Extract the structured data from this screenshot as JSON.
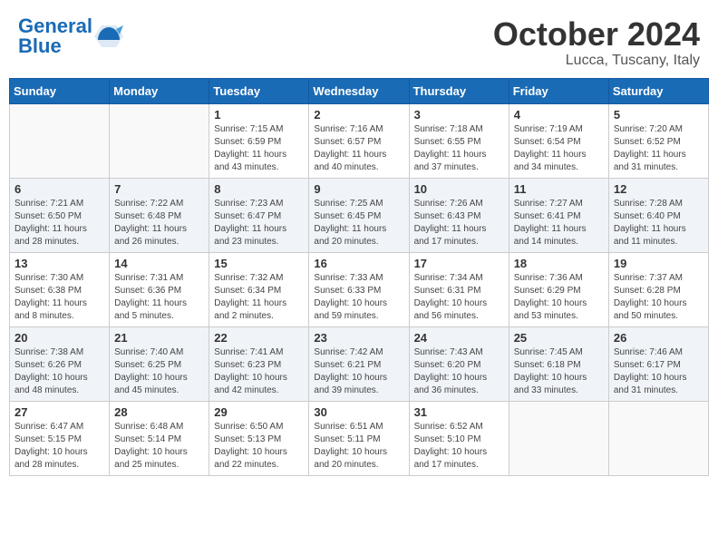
{
  "header": {
    "logo_text_general": "General",
    "logo_text_blue": "Blue",
    "month": "October 2024",
    "location": "Lucca, Tuscany, Italy"
  },
  "days_of_week": [
    "Sunday",
    "Monday",
    "Tuesday",
    "Wednesday",
    "Thursday",
    "Friday",
    "Saturday"
  ],
  "weeks": [
    [
      {
        "day": "",
        "sunrise": "",
        "sunset": "",
        "daylight": ""
      },
      {
        "day": "",
        "sunrise": "",
        "sunset": "",
        "daylight": ""
      },
      {
        "day": "1",
        "sunrise": "Sunrise: 7:15 AM",
        "sunset": "Sunset: 6:59 PM",
        "daylight": "Daylight: 11 hours and 43 minutes."
      },
      {
        "day": "2",
        "sunrise": "Sunrise: 7:16 AM",
        "sunset": "Sunset: 6:57 PM",
        "daylight": "Daylight: 11 hours and 40 minutes."
      },
      {
        "day": "3",
        "sunrise": "Sunrise: 7:18 AM",
        "sunset": "Sunset: 6:55 PM",
        "daylight": "Daylight: 11 hours and 37 minutes."
      },
      {
        "day": "4",
        "sunrise": "Sunrise: 7:19 AM",
        "sunset": "Sunset: 6:54 PM",
        "daylight": "Daylight: 11 hours and 34 minutes."
      },
      {
        "day": "5",
        "sunrise": "Sunrise: 7:20 AM",
        "sunset": "Sunset: 6:52 PM",
        "daylight": "Daylight: 11 hours and 31 minutes."
      }
    ],
    [
      {
        "day": "6",
        "sunrise": "Sunrise: 7:21 AM",
        "sunset": "Sunset: 6:50 PM",
        "daylight": "Daylight: 11 hours and 28 minutes."
      },
      {
        "day": "7",
        "sunrise": "Sunrise: 7:22 AM",
        "sunset": "Sunset: 6:48 PM",
        "daylight": "Daylight: 11 hours and 26 minutes."
      },
      {
        "day": "8",
        "sunrise": "Sunrise: 7:23 AM",
        "sunset": "Sunset: 6:47 PM",
        "daylight": "Daylight: 11 hours and 23 minutes."
      },
      {
        "day": "9",
        "sunrise": "Sunrise: 7:25 AM",
        "sunset": "Sunset: 6:45 PM",
        "daylight": "Daylight: 11 hours and 20 minutes."
      },
      {
        "day": "10",
        "sunrise": "Sunrise: 7:26 AM",
        "sunset": "Sunset: 6:43 PM",
        "daylight": "Daylight: 11 hours and 17 minutes."
      },
      {
        "day": "11",
        "sunrise": "Sunrise: 7:27 AM",
        "sunset": "Sunset: 6:41 PM",
        "daylight": "Daylight: 11 hours and 14 minutes."
      },
      {
        "day": "12",
        "sunrise": "Sunrise: 7:28 AM",
        "sunset": "Sunset: 6:40 PM",
        "daylight": "Daylight: 11 hours and 11 minutes."
      }
    ],
    [
      {
        "day": "13",
        "sunrise": "Sunrise: 7:30 AM",
        "sunset": "Sunset: 6:38 PM",
        "daylight": "Daylight: 11 hours and 8 minutes."
      },
      {
        "day": "14",
        "sunrise": "Sunrise: 7:31 AM",
        "sunset": "Sunset: 6:36 PM",
        "daylight": "Daylight: 11 hours and 5 minutes."
      },
      {
        "day": "15",
        "sunrise": "Sunrise: 7:32 AM",
        "sunset": "Sunset: 6:34 PM",
        "daylight": "Daylight: 11 hours and 2 minutes."
      },
      {
        "day": "16",
        "sunrise": "Sunrise: 7:33 AM",
        "sunset": "Sunset: 6:33 PM",
        "daylight": "Daylight: 10 hours and 59 minutes."
      },
      {
        "day": "17",
        "sunrise": "Sunrise: 7:34 AM",
        "sunset": "Sunset: 6:31 PM",
        "daylight": "Daylight: 10 hours and 56 minutes."
      },
      {
        "day": "18",
        "sunrise": "Sunrise: 7:36 AM",
        "sunset": "Sunset: 6:29 PM",
        "daylight": "Daylight: 10 hours and 53 minutes."
      },
      {
        "day": "19",
        "sunrise": "Sunrise: 7:37 AM",
        "sunset": "Sunset: 6:28 PM",
        "daylight": "Daylight: 10 hours and 50 minutes."
      }
    ],
    [
      {
        "day": "20",
        "sunrise": "Sunrise: 7:38 AM",
        "sunset": "Sunset: 6:26 PM",
        "daylight": "Daylight: 10 hours and 48 minutes."
      },
      {
        "day": "21",
        "sunrise": "Sunrise: 7:40 AM",
        "sunset": "Sunset: 6:25 PM",
        "daylight": "Daylight: 10 hours and 45 minutes."
      },
      {
        "day": "22",
        "sunrise": "Sunrise: 7:41 AM",
        "sunset": "Sunset: 6:23 PM",
        "daylight": "Daylight: 10 hours and 42 minutes."
      },
      {
        "day": "23",
        "sunrise": "Sunrise: 7:42 AM",
        "sunset": "Sunset: 6:21 PM",
        "daylight": "Daylight: 10 hours and 39 minutes."
      },
      {
        "day": "24",
        "sunrise": "Sunrise: 7:43 AM",
        "sunset": "Sunset: 6:20 PM",
        "daylight": "Daylight: 10 hours and 36 minutes."
      },
      {
        "day": "25",
        "sunrise": "Sunrise: 7:45 AM",
        "sunset": "Sunset: 6:18 PM",
        "daylight": "Daylight: 10 hours and 33 minutes."
      },
      {
        "day": "26",
        "sunrise": "Sunrise: 7:46 AM",
        "sunset": "Sunset: 6:17 PM",
        "daylight": "Daylight: 10 hours and 31 minutes."
      }
    ],
    [
      {
        "day": "27",
        "sunrise": "Sunrise: 6:47 AM",
        "sunset": "Sunset: 5:15 PM",
        "daylight": "Daylight: 10 hours and 28 minutes."
      },
      {
        "day": "28",
        "sunrise": "Sunrise: 6:48 AM",
        "sunset": "Sunset: 5:14 PM",
        "daylight": "Daylight: 10 hours and 25 minutes."
      },
      {
        "day": "29",
        "sunrise": "Sunrise: 6:50 AM",
        "sunset": "Sunset: 5:13 PM",
        "daylight": "Daylight: 10 hours and 22 minutes."
      },
      {
        "day": "30",
        "sunrise": "Sunrise: 6:51 AM",
        "sunset": "Sunset: 5:11 PM",
        "daylight": "Daylight: 10 hours and 20 minutes."
      },
      {
        "day": "31",
        "sunrise": "Sunrise: 6:52 AM",
        "sunset": "Sunset: 5:10 PM",
        "daylight": "Daylight: 10 hours and 17 minutes."
      },
      {
        "day": "",
        "sunrise": "",
        "sunset": "",
        "daylight": ""
      },
      {
        "day": "",
        "sunrise": "",
        "sunset": "",
        "daylight": ""
      }
    ]
  ]
}
